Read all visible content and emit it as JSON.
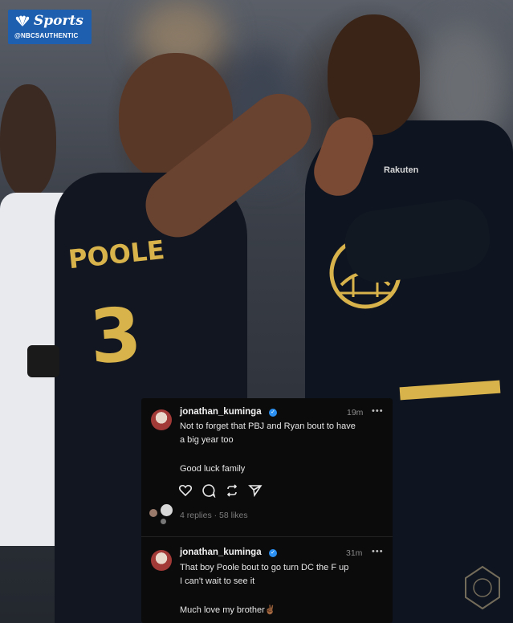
{
  "brand": {
    "name": "Sports",
    "handle": "@NBCSAUTHENTIC"
  },
  "photo": {
    "jersey_name": "POOLE",
    "jersey_number": "3",
    "sponsor": "Rakuten"
  },
  "comments": [
    {
      "username": "jonathan_kuminga",
      "time": "19m",
      "more": "•••",
      "lines": [
        "Not to forget that PBJ and Ryan bout to have",
        "a big year too",
        "",
        "Good luck family"
      ],
      "stats": "4 replies · 58 likes"
    },
    {
      "username": "jonathan_kuminga",
      "time": "31m",
      "more": "•••",
      "lines": [
        "That boy Poole bout to go turn DC the F up",
        "I can't wait to see it",
        "",
        "Much love my brother✌🏾"
      ]
    }
  ],
  "colors": {
    "card_bg": "#0b0b0c",
    "brand_blue": "#1e5fb0",
    "verified_blue": "#2a8ff0",
    "jersey_gold": "#d8b24a"
  }
}
